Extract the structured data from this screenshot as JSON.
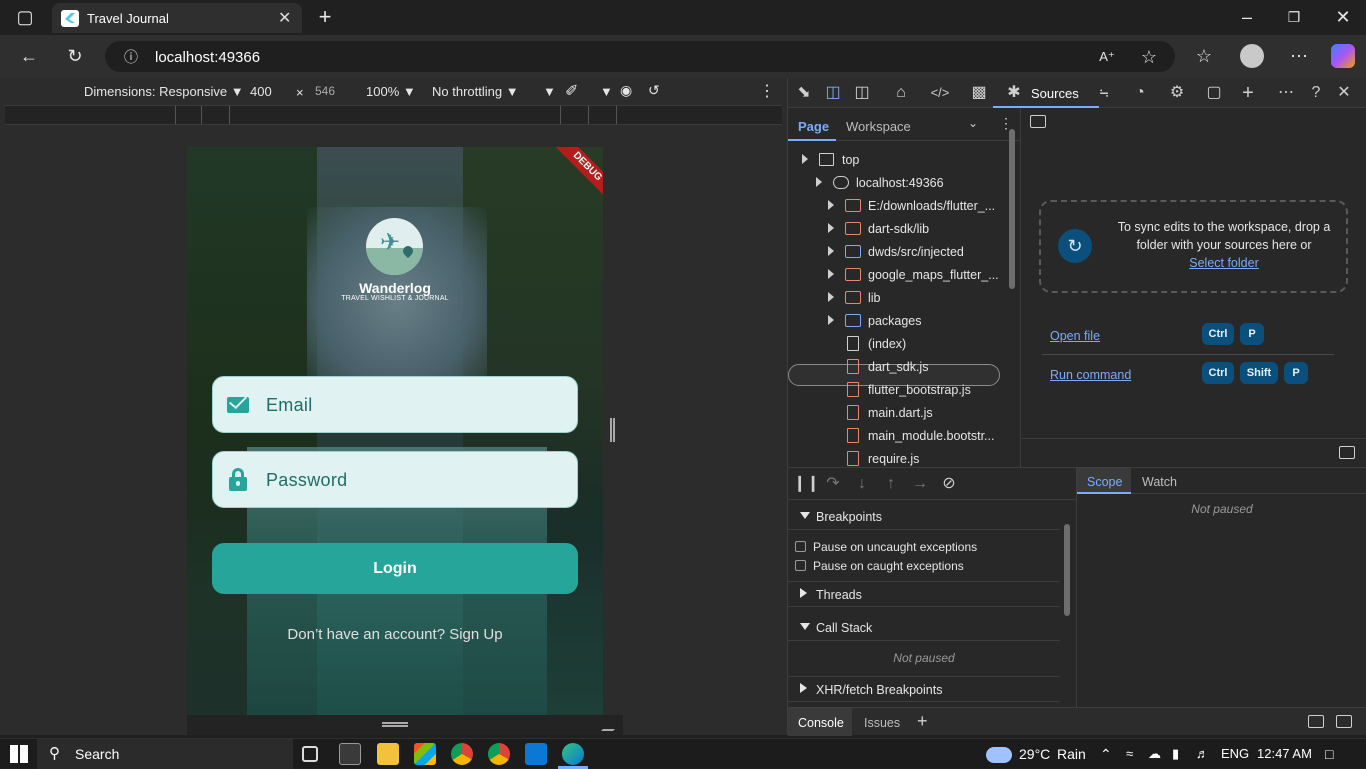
{
  "browser": {
    "tab_title": "Travel Journal",
    "url": "localhost:49366",
    "new_tab_label": "+"
  },
  "device_toolbar": {
    "dimensions": "Dimensions: Responsive",
    "width": "400",
    "times": "×",
    "height": "546",
    "zoom": "100%",
    "throttling": "No throttling"
  },
  "app": {
    "debug_banner": "DEBUG",
    "brand": "Wanderlog",
    "tagline": "TRAVEL WISHLIST & JOURNAL",
    "email_label": "Email",
    "password_label": "Password",
    "login_button": "Login",
    "signup_prompt": "Don’t have an account? Sign Up",
    "colors": {
      "accent": "#26a69a",
      "field_bg": "#e0f2f1"
    }
  },
  "devtools": {
    "active_tab": "Sources",
    "nav_tabs": {
      "page": "Page",
      "workspace": "Workspace"
    },
    "tree": [
      {
        "label": "top",
        "indent": 0,
        "icon": "frame-icon",
        "expand": "collapsed"
      },
      {
        "label": "localhost:49366",
        "indent": 1,
        "icon": "cloud-icon",
        "expand": "collapsed"
      },
      {
        "label": "E:/downloads/flutter_...",
        "indent": 2,
        "icon": "folder-icon",
        "expand": "collapsed"
      },
      {
        "label": "dart-sdk/lib",
        "indent": 2,
        "icon": "folder-icon",
        "expand": "collapsed"
      },
      {
        "label": "dwds/src/injected",
        "indent": 2,
        "icon": "folder-blue-icon",
        "expand": "collapsed"
      },
      {
        "label": "google_maps_flutter_...",
        "indent": 2,
        "icon": "folder-icon",
        "expand": "collapsed"
      },
      {
        "label": "lib",
        "indent": 2,
        "icon": "folder-icon",
        "expand": "collapsed"
      },
      {
        "label": "packages",
        "indent": 2,
        "icon": "folder-blue-icon",
        "expand": "collapsed"
      },
      {
        "label": "(index)",
        "indent": 2,
        "icon": "file-gray-icon",
        "expand": "none"
      },
      {
        "label": "dart_sdk.js",
        "indent": 2,
        "icon": "file-icon",
        "expand": "none"
      },
      {
        "label": "flutter_bootstrap.js",
        "indent": 2,
        "icon": "file-icon",
        "expand": "none"
      },
      {
        "label": "main.dart.js",
        "indent": 2,
        "icon": "file-icon",
        "expand": "none"
      },
      {
        "label": "main_module.bootstr...",
        "indent": 2,
        "icon": "file-icon",
        "expand": "none"
      },
      {
        "label": "require.js",
        "indent": 2,
        "icon": "file-icon",
        "expand": "none"
      }
    ],
    "workspace_hint": "To sync edits to the workspace, drop a folder with your sources here or",
    "select_folder": "Select folder",
    "open_file": "Open file",
    "run_command": "Run command",
    "keys": {
      "ctrl": "Ctrl",
      "shift": "Shift",
      "p": "P"
    },
    "breakpoints": "Breakpoints",
    "pause_uncaught": "Pause on uncaught exceptions",
    "pause_caught": "Pause on caught exceptions",
    "threads": "Threads",
    "call_stack": "Call Stack",
    "not_paused": "Not paused",
    "xhr_breakpoints": "XHR/fetch Breakpoints",
    "scope": "Scope",
    "watch": "Watch",
    "console": "Console",
    "issues": "Issues"
  },
  "taskbar": {
    "search": "Search",
    "temperature": "29°C",
    "weather": "Rain",
    "language": "ENG",
    "time": "12:47 AM"
  }
}
